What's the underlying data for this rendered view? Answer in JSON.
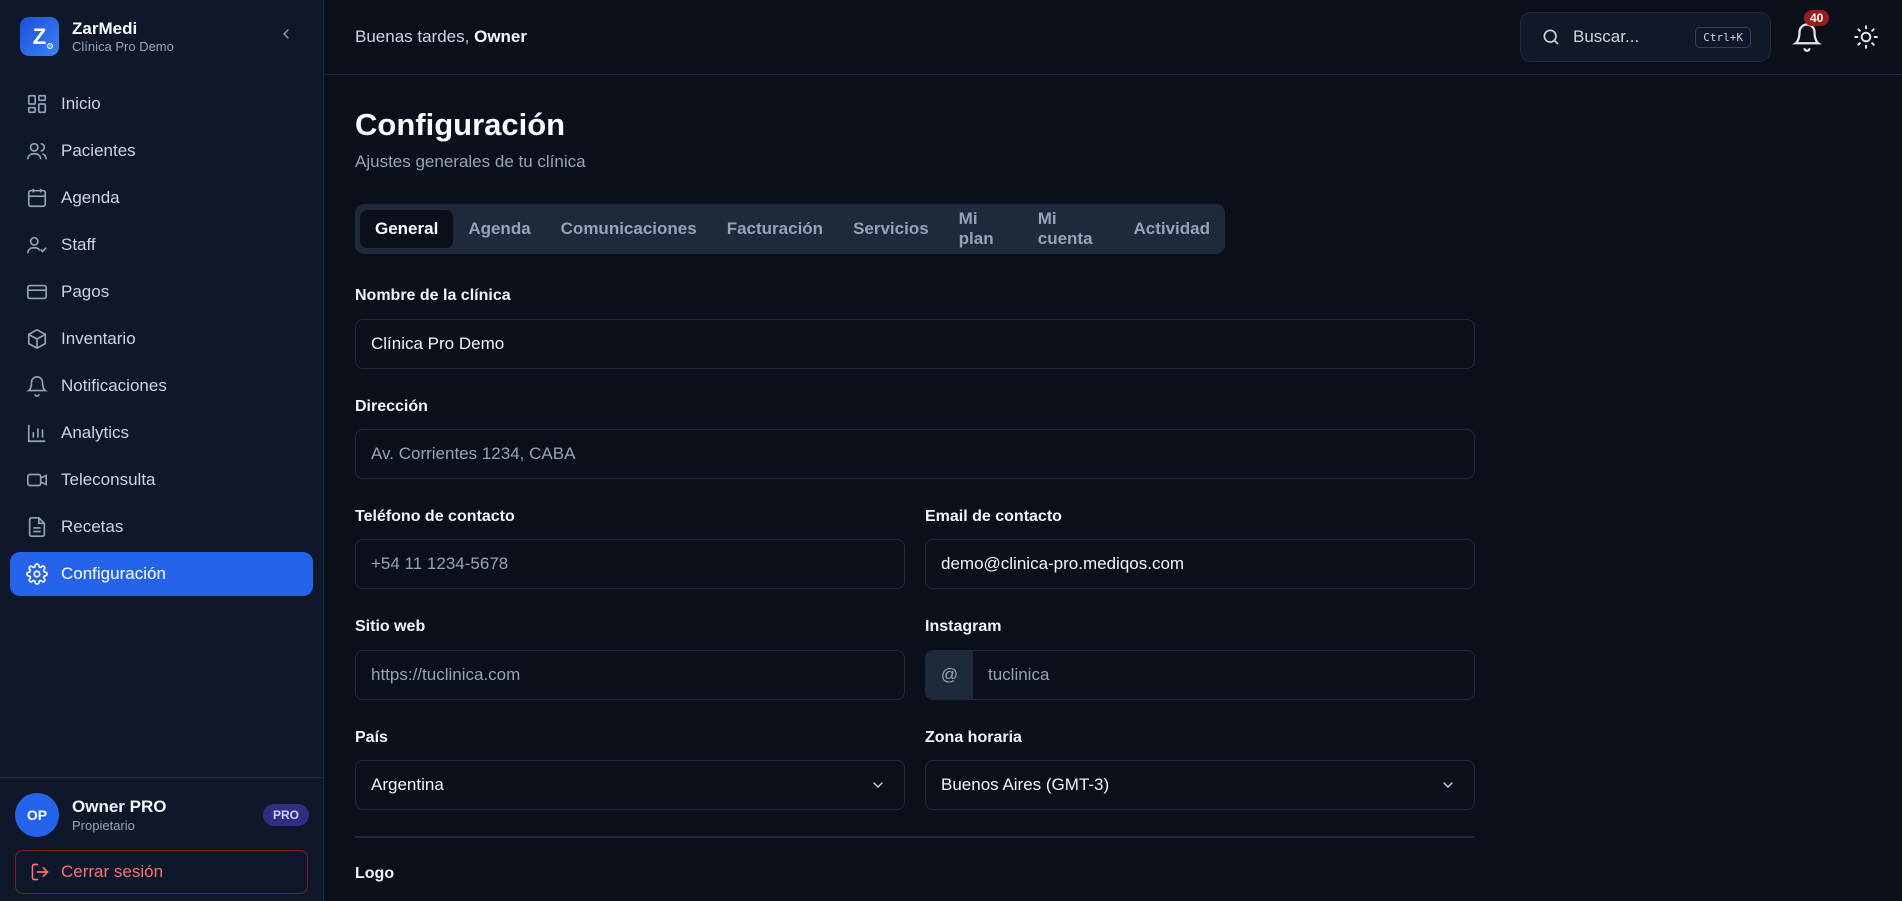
{
  "brand": {
    "letter": "Z",
    "name": "ZarMedi",
    "subtitle": "Clínica Pro Demo"
  },
  "nav": [
    {
      "label": "Inicio",
      "icon": "dashboard-icon"
    },
    {
      "label": "Pacientes",
      "icon": "users-icon"
    },
    {
      "label": "Agenda",
      "icon": "calendar-icon"
    },
    {
      "label": "Staff",
      "icon": "user-check-icon"
    },
    {
      "label": "Pagos",
      "icon": "credit-card-icon"
    },
    {
      "label": "Inventario",
      "icon": "box-icon"
    },
    {
      "label": "Notificaciones",
      "icon": "bell-icon"
    },
    {
      "label": "Analytics",
      "icon": "bar-chart-icon"
    },
    {
      "label": "Teleconsulta",
      "icon": "video-icon"
    },
    {
      "label": "Recetas",
      "icon": "file-text-icon"
    },
    {
      "label": "Configuración",
      "icon": "gear-icon",
      "active": true
    }
  ],
  "user": {
    "initials": "OP",
    "name": "Owner PRO",
    "role": "Propietario",
    "badge": "PRO"
  },
  "logout_label": "Cerrar sesión",
  "header": {
    "greeting_prefix": "Buenas tardes,",
    "greeting_name": "Owner",
    "search_placeholder": "Buscar...",
    "search_shortcut": "Ctrl+K",
    "notification_count": "40"
  },
  "page": {
    "title": "Configuración",
    "subtitle": "Ajustes generales de tu clínica",
    "tabs": [
      "General",
      "Agenda",
      "Comunicaciones",
      "Facturación",
      "Servicios",
      "Mi plan",
      "Mi cuenta",
      "Actividad"
    ],
    "active_tab": "General"
  },
  "form": {
    "clinic_name": {
      "label": "Nombre de la clínica",
      "value": "Clínica Pro Demo"
    },
    "address": {
      "label": "Dirección",
      "placeholder": "Av. Corrientes 1234, CABA"
    },
    "phone": {
      "label": "Teléfono de contacto",
      "placeholder": "+54 11 1234-5678"
    },
    "email": {
      "label": "Email de contacto",
      "value": "demo@clinica-pro.mediqos.com"
    },
    "website": {
      "label": "Sitio web",
      "placeholder": "https://tuclinica.com"
    },
    "instagram": {
      "label": "Instagram",
      "prefix": "@",
      "placeholder": "tuclinica"
    },
    "country": {
      "label": "País",
      "value": "Argentina"
    },
    "timezone": {
      "label": "Zona horaria",
      "value": "Buenos Aires (GMT-3)"
    },
    "logo": {
      "label": "Logo"
    }
  },
  "colors": {
    "accent": "#2563eb",
    "background": "#0b0f1a",
    "sidebar": "#0f172a",
    "danger": "#f87171"
  }
}
